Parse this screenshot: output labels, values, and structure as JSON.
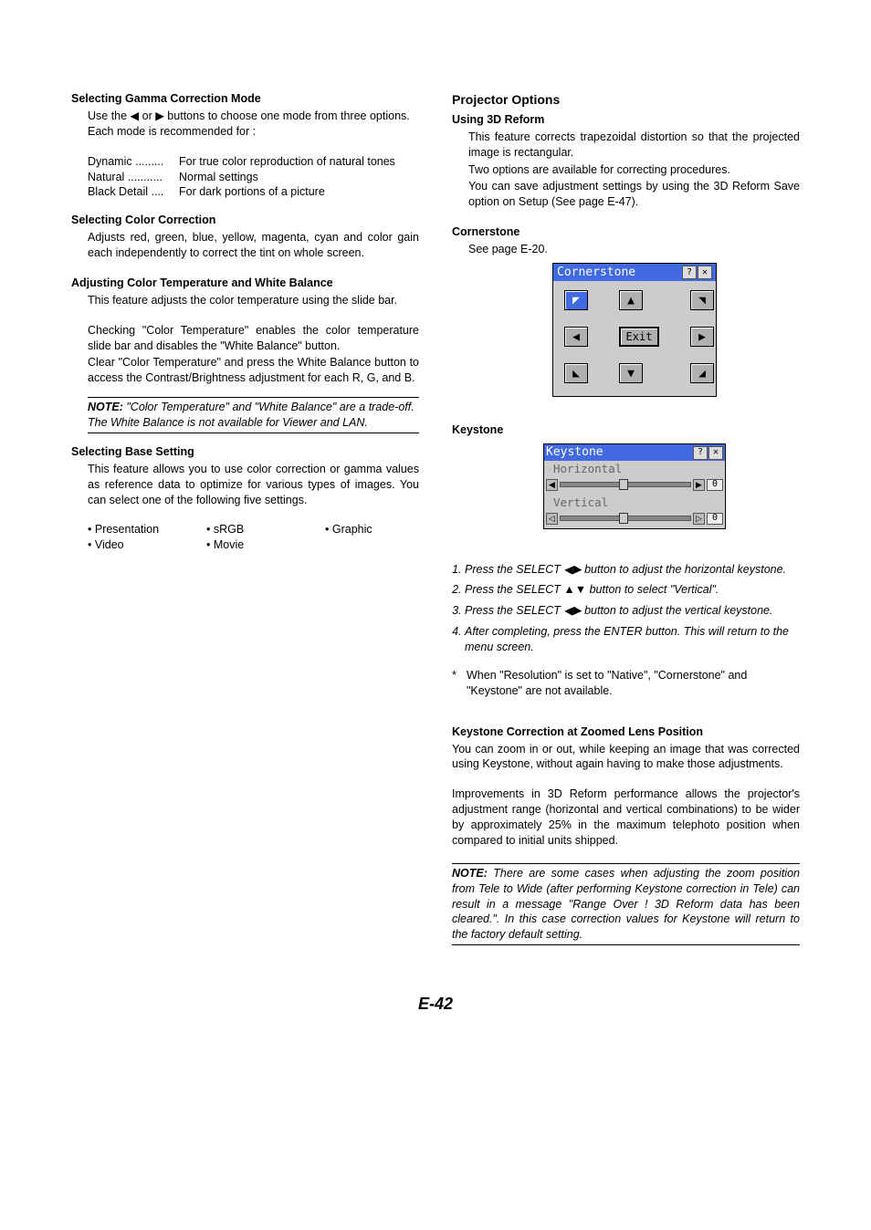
{
  "pageNumber": "E-42",
  "left": {
    "gamma": {
      "title": "Selecting Gamma Correction Mode",
      "intro": "Use the ◀ or ▶ buttons to choose one mode from three options. Each mode is recommended for :",
      "rows": [
        {
          "term": "Dynamic .........",
          "desc": "For true color reproduction of natural tones"
        },
        {
          "term": "Natural ...........",
          "desc": "Normal settings"
        },
        {
          "term": "Black Detail ....",
          "desc": "For dark portions of a picture"
        }
      ]
    },
    "color": {
      "title": "Selecting Color Correction",
      "body": "Adjusts red, green, blue, yellow, magenta, cyan and color gain each independently to correct the tint on whole screen."
    },
    "temp": {
      "title": "Adjusting Color Temperature and White Balance",
      "p1": "This feature adjusts the color temperature using the slide bar.",
      "p2": "Checking \"Color Temperature\" enables the color temperature slide bar and disables the \"White Balance\" button.",
      "p3": "Clear \"Color Temperature\" and press the White Balance button to access the Contrast/Brightness adjustment for each R, G, and B."
    },
    "note": {
      "label": "NOTE:",
      "text": " \"Color Temperature\" and \"White Balance\" are a trade-off. The White Balance is not available for Viewer and LAN."
    },
    "base": {
      "title": "Selecting Base Setting",
      "body": "This feature allows you to use color correction or gamma values as reference data to optimize for various types of images. You can select one of the following five settings.",
      "col1": [
        "Presentation",
        "Video"
      ],
      "col2": [
        "sRGB",
        "Movie"
      ],
      "col3": [
        "Graphic"
      ]
    }
  },
  "right": {
    "header": "Projector Options",
    "reform": {
      "title": "Using 3D Reform",
      "p1": "This feature corrects trapezoidal distortion so that the projected image is rectangular.",
      "p2": "Two options are available for correcting procedures.",
      "p3": "You can save adjustment settings by using the 3D Reform Save option on Setup (See page E-47)."
    },
    "corner": {
      "title": "Cornerstone",
      "see": "See page E-20.",
      "osd": {
        "title": "Cornerstone",
        "exit": "Exit"
      }
    },
    "keystone": {
      "title": "Keystone",
      "osd": {
        "title": "Keystone",
        "h": "Horizontal",
        "v": "Vertical",
        "val": "0"
      },
      "steps": [
        "Press the SELECT ◀▶ button to adjust the horizontal keystone.",
        "Press the SELECT ▲▼ button to select \"Vertical\".",
        "Press the SELECT ◀▶ button to adjust the vertical keystone.",
        "After completing, press the ENTER button. This will return to the menu screen."
      ],
      "footnote": "When \"Resolution\" is set to \"Native\", \"Cornerstone\" and \"Keystone\" are not available."
    },
    "zoom": {
      "title": "Keystone Correction at Zoomed Lens Position",
      "p1": "You can zoom in or out, while keeping an image that was corrected using Keystone, without again having to make those adjustments.",
      "p2": "Improvements in 3D Reform performance allows the projector's adjustment range (horizontal and vertical combinations) to be wider by approximately 25% in the maximum telephoto position when compared to initial units shipped."
    },
    "note2": {
      "label": "NOTE:",
      "text": " There are some cases when adjusting the zoom position from Tele to Wide (after performing Keystone correction in Tele) can result in a message \"Range Over ! 3D Reform data has been cleared.\". In this case correction values for Keystone will return to the factory default setting."
    }
  }
}
